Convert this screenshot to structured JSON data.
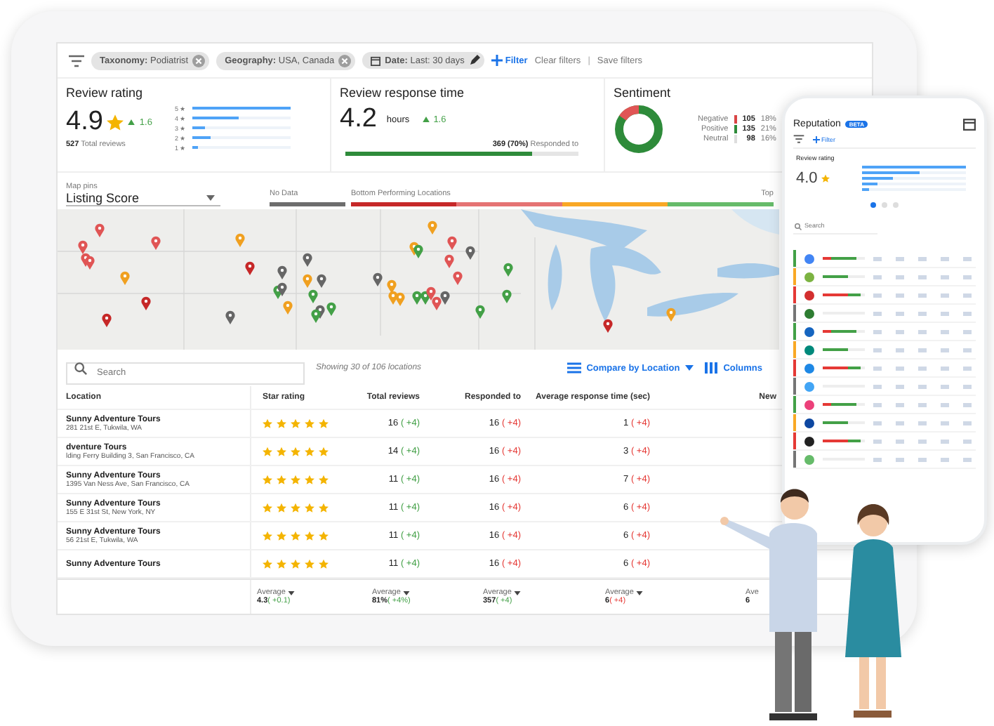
{
  "filters": {
    "chips": [
      {
        "kind": "removable",
        "label": "**Taxonomy:** Podiatrist"
      },
      {
        "kind": "removable",
        "label": "**Geography:** USA, Canada"
      },
      {
        "kind": "editable",
        "label": "**Date:** Last: 30 days"
      }
    ],
    "add": "Filter",
    "clear": "Clear filters",
    "separator": "|",
    "save": "Save filters"
  },
  "review_rating": {
    "title": "Review rating",
    "value": "4.9",
    "change": "1.6",
    "count": "527",
    "count_label": "Total reviews",
    "distribution": [
      {
        "label": "5 ★",
        "level": 1
      },
      {
        "label": "4 ★",
        "level": 0.46
      },
      {
        "label": "3 ★",
        "level": 0.12
      },
      {
        "label": "2 ★",
        "level": 0.18
      },
      {
        "label": "1 ★",
        "level": 0.05
      }
    ]
  },
  "response_time": {
    "title": "Review response time",
    "value": "4.2",
    "unit": "hours",
    "change": "1.6",
    "responded_count": "369",
    "responded_share": "(70%)",
    "responded_label": "Responded to",
    "level": 0.8
  },
  "sentiment": {
    "title": "Sentiment",
    "rows": [
      {
        "label": "Negative",
        "count": "105",
        "share": "18%",
        "color": "#d94545"
      },
      {
        "label": "Positive",
        "count": "135",
        "share": "21%",
        "color": "#2e8b3a"
      },
      {
        "label": "Neutral",
        "count": "98",
        "share": "16%",
        "color": "#dddddd"
      }
    ]
  },
  "map": {
    "pins_label": "Map pins",
    "pins_value": "Listing Score",
    "no_data": "No Data",
    "bottom": "Bottom Performing Locations",
    "top": "Top"
  },
  "toolbar": {
    "search_placeholder": "Search",
    "showing": "Showing 30 of 106 locations",
    "compare": "Compare by Location",
    "columns": "Columns"
  },
  "table": {
    "columns": [
      "Location",
      "Star rating",
      "Total reviews",
      "Responded to",
      "Average response time (sec)",
      "New"
    ],
    "rows": [
      {
        "name": "Sunny Adventure Tours",
        "address": "281 21st E, Tukwila, WA",
        "stars": 5,
        "total": "16",
        "total_delta": "( +4)",
        "responded": "16",
        "responded_delta": "( +4)",
        "avg": "1",
        "avg_delta": "( +4)"
      },
      {
        "name": "dventure Tours",
        "address": "lding Ferry Building 3, San Francisco, CA",
        "stars": 5,
        "total": "14",
        "total_delta": "( +4)",
        "responded": "16",
        "responded_delta": "( +4)",
        "avg": "3",
        "avg_delta": "( +4)"
      },
      {
        "name": "Sunny Adventure Tours",
        "address": "1395 Van Ness Ave, San Francisco, CA",
        "stars": 5,
        "total": "11",
        "total_delta": "( +4)",
        "responded": "16",
        "responded_delta": "( +4)",
        "avg": "7",
        "avg_delta": "( +4)"
      },
      {
        "name": "Sunny Adventure Tours",
        "address": "155 E 31st St, New York, NY",
        "stars": 5,
        "total": "11",
        "total_delta": "( +4)",
        "responded": "16",
        "responded_delta": "( +4)",
        "avg": "6",
        "avg_delta": "( +4)"
      },
      {
        "name": "Sunny Adventure Tours",
        "address": "56 21st E, Tukwila, WA",
        "stars": 5,
        "total": "11",
        "total_delta": "( +4)",
        "responded": "16",
        "responded_delta": "( +4)",
        "avg": "6",
        "avg_delta": "( +4)"
      },
      {
        "name": "Sunny Adventure Tours",
        "stars": 5,
        "total": "11",
        "total_delta": "( +4)",
        "responded": "16",
        "responded_delta": "( +4)",
        "avg": "6",
        "avg_delta": "( +4)"
      }
    ],
    "footer": [
      {
        "label": "Average",
        "value": "4.3",
        "delta": "( +0.1)",
        "positive": true
      },
      {
        "label": "Average",
        "value": "81%",
        "delta": "( +4%)",
        "positive": true
      },
      {
        "label": "Average",
        "value": "357",
        "delta": "( +4)",
        "positive": true
      },
      {
        "label": "Average",
        "value": "6",
        "delta": "( +4)",
        "positive": false
      },
      {
        "label": "Ave",
        "value": "6"
      }
    ]
  },
  "phone": {
    "title": "Reputation",
    "badge": "BETA",
    "filter": "Filter",
    "rating_title": "Review rating",
    "rating_value": "4.0",
    "distribution": [
      {
        "level": 1
      },
      {
        "level": 0.55
      },
      {
        "level": 0.3
      },
      {
        "level": 0.14
      },
      {
        "level": 0.07
      }
    ],
    "carousel": [
      {
        "selected": true
      },
      {
        "selected": false
      },
      {
        "selected": false
      }
    ],
    "search_placeholder": "Search",
    "rows": [
      {
        "color": "#43a047",
        "icon": {
          "color": "#4285f4"
        }
      },
      {
        "color": "#f9a825",
        "icon": {
          "color": "#7cb342"
        }
      },
      {
        "color": "#e53935",
        "icon": {
          "color": "#d32f2f"
        }
      },
      {
        "color": "#757575",
        "icon": {
          "color": "#2e7d32"
        }
      },
      {
        "color": "#43a047",
        "icon": {
          "color": "#1565c0"
        }
      },
      {
        "color": "#f9a825",
        "icon": {
          "color": "#00897b"
        }
      },
      {
        "color": "#e53935",
        "icon": {
          "color": "#1e88e5"
        }
      },
      {
        "color": "#757575",
        "icon": {
          "color": "#42a5f5"
        }
      },
      {
        "color": "#43a047",
        "icon": {
          "color": "#ec407a"
        }
      },
      {
        "color": "#f9a825",
        "icon": {
          "color": "#0d47a1"
        }
      },
      {
        "color": "#e53935",
        "icon": {
          "color": "#212121"
        }
      },
      {
        "color": "#757575",
        "icon": {
          "color": "#66bb6a"
        }
      }
    ]
  }
}
